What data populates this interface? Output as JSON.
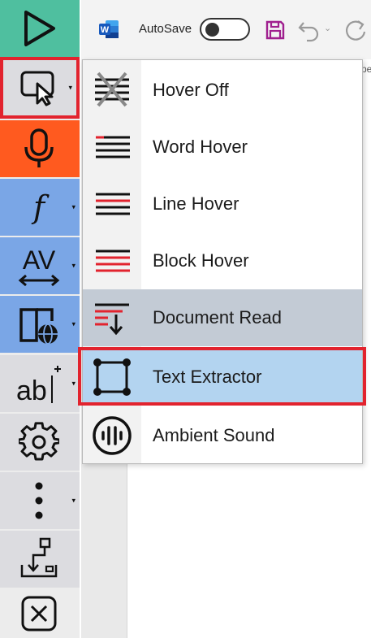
{
  "word": {
    "app_icon": "word-icon",
    "autosave_label": "AutoSave",
    "autosave_state": "off",
    "tab_hint": "pe"
  },
  "toolbar": {
    "items": [
      {
        "name": "play",
        "icon": "play-icon",
        "color": "#4fbf9f"
      },
      {
        "name": "hover-mode",
        "icon": "cursor-pointer-icon",
        "color": "#dcdce0",
        "has_dropdown": true,
        "highlighted": true
      },
      {
        "name": "microphone",
        "icon": "microphone-icon",
        "color": "#ff5a1f"
      },
      {
        "name": "font",
        "icon": "font-f-icon",
        "color": "#7aa6e6",
        "has_dropdown": true
      },
      {
        "name": "spacing",
        "icon": "letter-spacing-icon",
        "color": "#7aa6e6",
        "has_dropdown": true
      },
      {
        "name": "translate",
        "icon": "book-globe-icon",
        "color": "#7aa6e6",
        "has_dropdown": true
      },
      {
        "name": "text-insert",
        "icon": "ab-cursor-icon",
        "color": "#dcdce0",
        "has_dropdown": true
      },
      {
        "name": "settings",
        "icon": "gear-icon",
        "color": "#dcdce0"
      },
      {
        "name": "more",
        "icon": "vertical-dots-icon",
        "color": "#dcdce0",
        "has_dropdown": true
      },
      {
        "name": "download",
        "icon": "download-icon",
        "color": "#dcdce0"
      },
      {
        "name": "close",
        "icon": "close-icon",
        "color": "#ececec"
      }
    ]
  },
  "menu": {
    "items": [
      {
        "label": "Hover Off",
        "icon": "hover-off-icon"
      },
      {
        "label": "Word Hover",
        "icon": "word-hover-icon"
      },
      {
        "label": "Line Hover",
        "icon": "line-hover-icon"
      },
      {
        "label": "Block Hover",
        "icon": "block-hover-icon"
      },
      {
        "label": "Document Read",
        "icon": "document-read-icon",
        "state": "hover"
      },
      {
        "label": "Text Extractor",
        "icon": "text-extractor-icon",
        "state": "selected",
        "highlighted": true
      },
      {
        "label": "Ambient Sound",
        "icon": "ambient-sound-icon"
      }
    ]
  },
  "colors": {
    "highlight_red": "#e2232e",
    "selected_blue": "#b3d4f0",
    "hover_gray": "#c3cbd5",
    "word_blue": "#185abd",
    "save_purple": "#a0208f"
  }
}
